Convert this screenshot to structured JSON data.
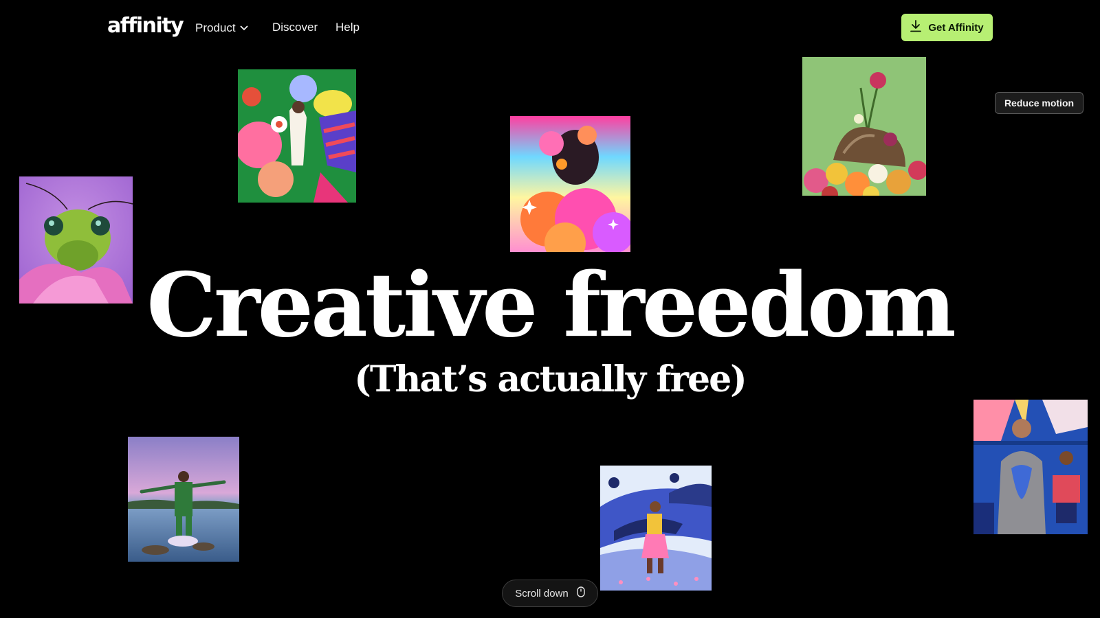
{
  "nav": {
    "logo": "affinity",
    "items": [
      {
        "label": "Product",
        "has_dropdown": true
      },
      {
        "label": "Discover"
      },
      {
        "label": "Help"
      }
    ],
    "cta_label": "Get Affinity",
    "cta_icon": "download-icon",
    "cta_color": "#b7ef73"
  },
  "reduce_motion_label": "Reduce motion",
  "hero": {
    "title": "Creative freedom",
    "subtitle": "(That’s actually free)"
  },
  "scroll": {
    "label": "Scroll down",
    "icon": "mouse-icon"
  },
  "artworks": [
    {
      "subject": "floral-illustration",
      "dominant_color": "#1f8f3e"
    },
    {
      "subject": "flower-portrait",
      "dominant_color": "#ff5fa2"
    },
    {
      "subject": "bouquet-collage",
      "dominant_color": "#8fc477"
    },
    {
      "subject": "green-insect-macro",
      "dominant_color": "#b774d6"
    },
    {
      "subject": "figure-in-water",
      "dominant_color": "#8d7fb8"
    },
    {
      "subject": "whales-illustration",
      "dominant_color": "#3f56c7"
    },
    {
      "subject": "metro-illustration",
      "dominant_color": "#2350b5"
    }
  ]
}
